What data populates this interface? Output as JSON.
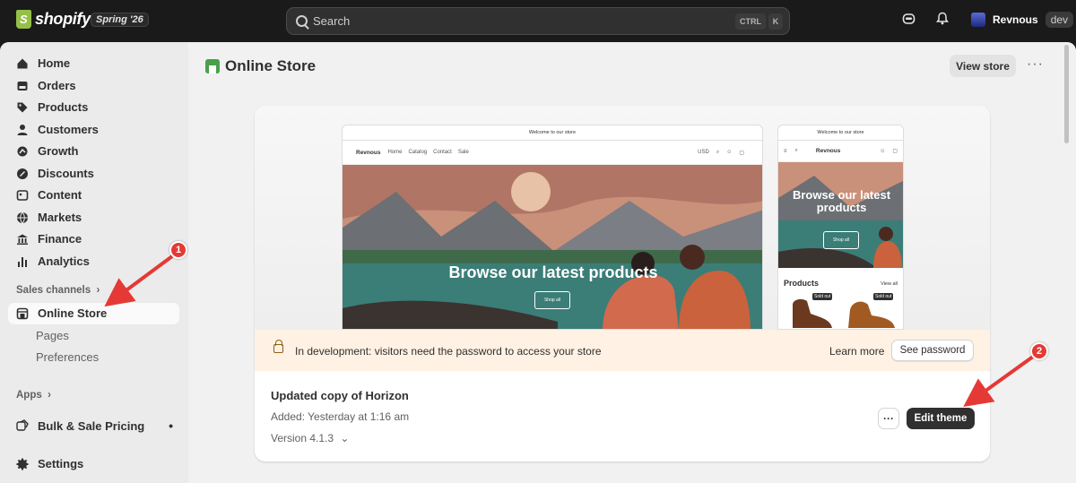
{
  "topbar": {
    "logo_text": "shopify",
    "edition": "Spring '26",
    "search_placeholder": "Search",
    "shortcut_ctrl": "CTRL",
    "shortcut_k": "K",
    "user_name": "Revnous",
    "user_badge": "dev"
  },
  "sidebar": {
    "items": [
      {
        "label": "Home",
        "icon": "home-icon"
      },
      {
        "label": "Orders",
        "icon": "orders-icon"
      },
      {
        "label": "Products",
        "icon": "tag-icon"
      },
      {
        "label": "Customers",
        "icon": "person-icon"
      },
      {
        "label": "Growth",
        "icon": "growth-icon"
      },
      {
        "label": "Discounts",
        "icon": "discount-icon"
      },
      {
        "label": "Content",
        "icon": "content-icon"
      },
      {
        "label": "Markets",
        "icon": "globe-icon"
      },
      {
        "label": "Finance",
        "icon": "bank-icon"
      },
      {
        "label": "Analytics",
        "icon": "chart-icon"
      }
    ],
    "sales_channels_label": "Sales channels",
    "online_store_label": "Online Store",
    "sub_items": [
      "Pages",
      "Preferences"
    ],
    "apps_label": "Apps",
    "app_item": "Bulk & Sale Pricing",
    "settings_label": "Settings"
  },
  "main": {
    "title": "Online Store",
    "view_store_label": "View store",
    "more_label": "···",
    "preview": {
      "announcement": "Welcome to our store",
      "brand": "Revnous",
      "nav": [
        "Home",
        "Catalog",
        "Contact",
        "Sale"
      ],
      "currency": "USD",
      "hero_title": "Browse our latest products",
      "hero_title_mobile": "Browse our latest products",
      "shop_all": "Shop all",
      "products_heading": "Products",
      "view_all": "View all",
      "sold_out": "Sold out"
    },
    "banner": {
      "text": "In development: visitors need the password to access your store",
      "learn_more": "Learn more",
      "see_password": "See password"
    },
    "theme": {
      "name": "Updated copy of Horizon",
      "added": "Added: Yesterday at 1:16 am",
      "version": "Version 4.1.3",
      "more_button": "···",
      "edit_button": "Edit theme"
    }
  },
  "annotations": {
    "badge_1": "1",
    "badge_2": "2",
    "color": "#e53935"
  }
}
